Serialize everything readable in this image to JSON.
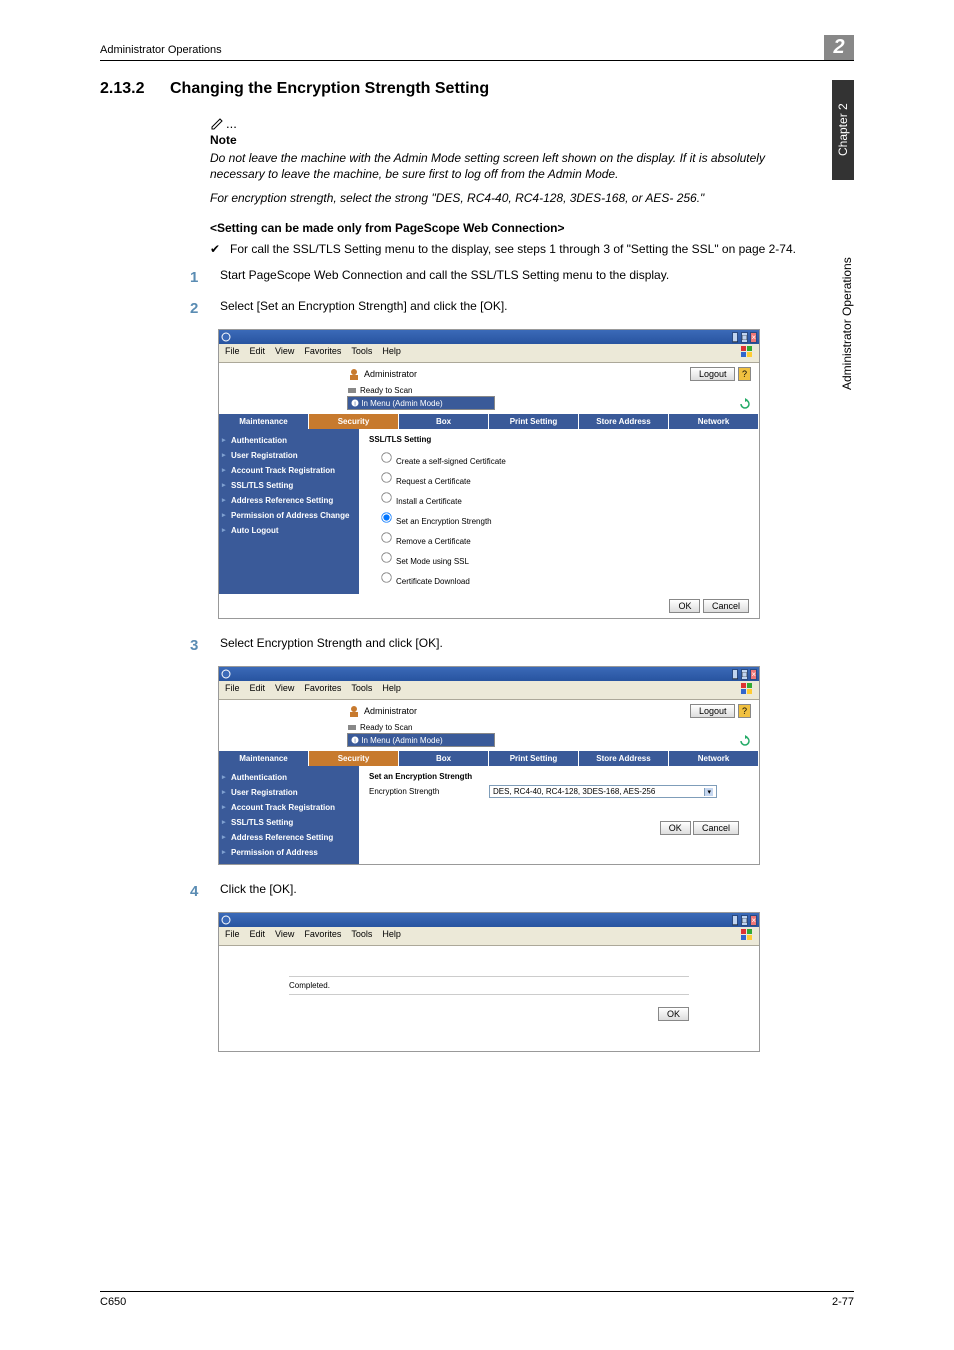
{
  "header": {
    "running_head": "Administrator Operations",
    "chapter_badge": "2"
  },
  "sidetab": {
    "chapter": "Chapter 2",
    "title": "Administrator Operations"
  },
  "section": {
    "number": "2.13.2",
    "title": "Changing the Encryption Strength Setting"
  },
  "note": {
    "dots": "...",
    "heading": "Note",
    "para1": "Do not leave the machine with the Admin Mode setting screen left shown on the display. If it is absolutely necessary to leave the machine, be sure first to log off from the Admin Mode.",
    "para2": "For encryption strength, select the strong \"DES, RC4-40, RC4-128, 3DES-168, or AES- 256.\""
  },
  "sub_heading": "<Setting can be made only from PageScope Web Connection>",
  "check_item": "For call the SSL/TLS Setting menu to the display, see steps 1 through 3 of \"Setting the SSL\" on page 2-74.",
  "steps": {
    "s1": {
      "num": "1",
      "text": "Start PageScope Web Connection and call the SSL/TLS Setting menu to the display."
    },
    "s2": {
      "num": "2",
      "text": "Select [Set an Encryption Strength] and click the [OK]."
    },
    "s3": {
      "num": "3",
      "text": "Select Encryption Strength and click [OK]."
    },
    "s4": {
      "num": "4",
      "text": "Click the [OK]."
    }
  },
  "menus": {
    "file": "File",
    "edit": "Edit",
    "view": "View",
    "favorites": "Favorites",
    "tools": "Tools",
    "help": "Help"
  },
  "webapp": {
    "admin_label": "Administrator",
    "logout": "Logout",
    "ready": "Ready to Scan",
    "mode": "In Menu (Admin Mode)",
    "tabs": {
      "maintenance": "Maintenance",
      "security": "Security",
      "box": "Box",
      "print": "Print Setting",
      "store": "Store Address",
      "network": "Network"
    },
    "nav": {
      "auth": "Authentication",
      "user_reg": "User Registration",
      "acct_track": "Account Track Registration",
      "ssl": "SSL/TLS Setting",
      "addr_ref": "Address Reference Setting",
      "perm": "Permission of Address Change",
      "auto_logout": "Auto Logout",
      "perm_of_addr": "Permission of Address"
    },
    "ok": "OK",
    "cancel": "Cancel"
  },
  "screenshot1": {
    "form_title": "SSL/TLS Setting",
    "opts": {
      "create": "Create a self-signed Certificate",
      "request": "Request a Certificate",
      "install": "Install a Certificate",
      "set_enc": "Set an Encryption Strength",
      "remove": "Remove a Certificate",
      "set_mode": "Set Mode using SSL",
      "cert_dl": "Certificate Download"
    }
  },
  "screenshot2": {
    "form_title": "Set an Encryption Strength",
    "label": "Encryption Strength",
    "value": "DES, RC4-40, RC4-128, 3DES-168, AES-256"
  },
  "screenshot3": {
    "text": "Completed."
  },
  "footer": {
    "left": "C650",
    "right": "2-77"
  }
}
